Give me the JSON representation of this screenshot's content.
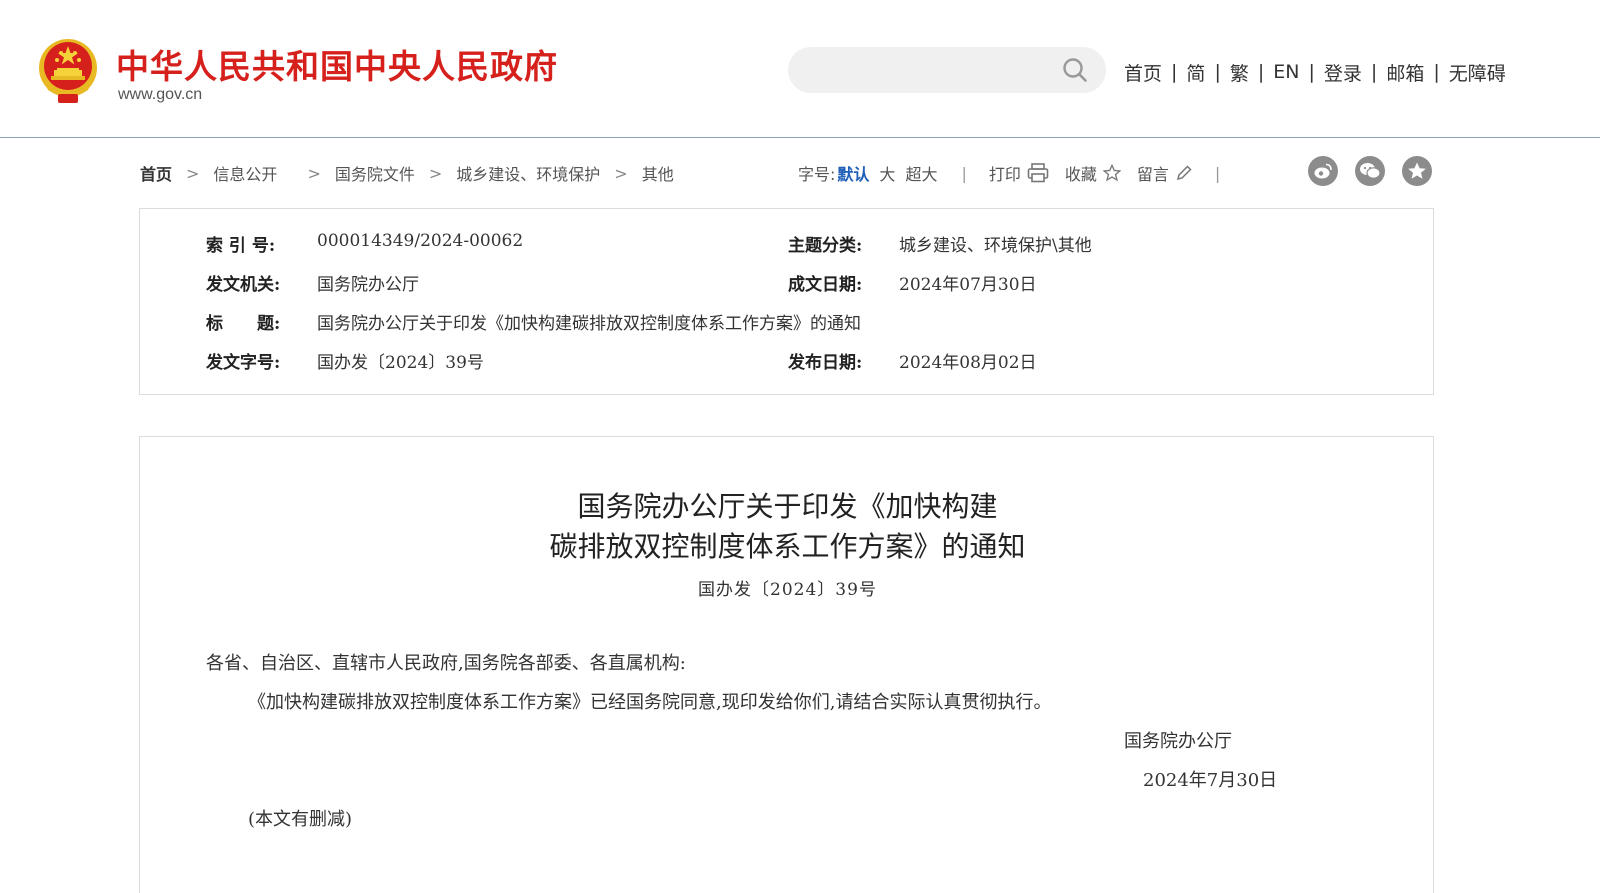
{
  "header": {
    "site_title": "中华人民共和国中央人民政府",
    "site_url": "www.gov.cn",
    "search_placeholder": "",
    "nav": [
      "首页",
      "简",
      "繁",
      "EN",
      "登录",
      "邮箱",
      "无障碍"
    ],
    "nav_separator": "|"
  },
  "breadcrumb": {
    "items": [
      "首页",
      "信息公开",
      "国务院文件",
      "城乡建设、环境保护",
      "其他"
    ],
    "arrow": ">"
  },
  "tools": {
    "font_size_label": "字号:",
    "font_sizes": [
      "默认",
      "大",
      "超大"
    ],
    "active_font_size": "默认",
    "divider": "|",
    "print": "打印",
    "favorite": "收藏",
    "comment": "留言"
  },
  "social_icons": [
    "weibo-icon",
    "wechat-icon",
    "favorite-star-icon"
  ],
  "meta": {
    "index_label": "索 引 号:",
    "index_value": "000014349/2024-00062",
    "topic_label": "主题分类:",
    "topic_value": "城乡建设、环境保护\\其他",
    "issuer_label": "发文机关:",
    "issuer_value": "国务院办公厅",
    "written_label": "成文日期:",
    "written_value": "2024年07月30日",
    "title_label": "标　　题:",
    "title_value": "国务院办公厅关于印发《加快构建碳排放双控制度体系工作方案》的通知",
    "docno_label": "发文字号:",
    "docno_value": "国办发〔2024〕39号",
    "published_label": "发布日期:",
    "published_value": "2024年08月02日"
  },
  "article": {
    "title_line1": "国务院办公厅关于印发《加快构建",
    "title_line2": "碳排放双控制度体系工作方案》的通知",
    "doc_number": "国办发〔2024〕39号",
    "salutation": "各省、自治区、直辖市人民政府,国务院各部委、各直属机构:",
    "body": "《加快构建碳排放双控制度体系工作方案》已经国务院同意,现印发给你们,请结合实际认真贯彻执行。",
    "signature": "国务院办公厅",
    "date": "2024年7月30日",
    "note": "(本文有删减)"
  },
  "colors": {
    "brand_red": "#d6201c",
    "active_blue": "#1f5fb8",
    "icon_gray": "#8c8c8c",
    "border": "#dcdcdc"
  }
}
